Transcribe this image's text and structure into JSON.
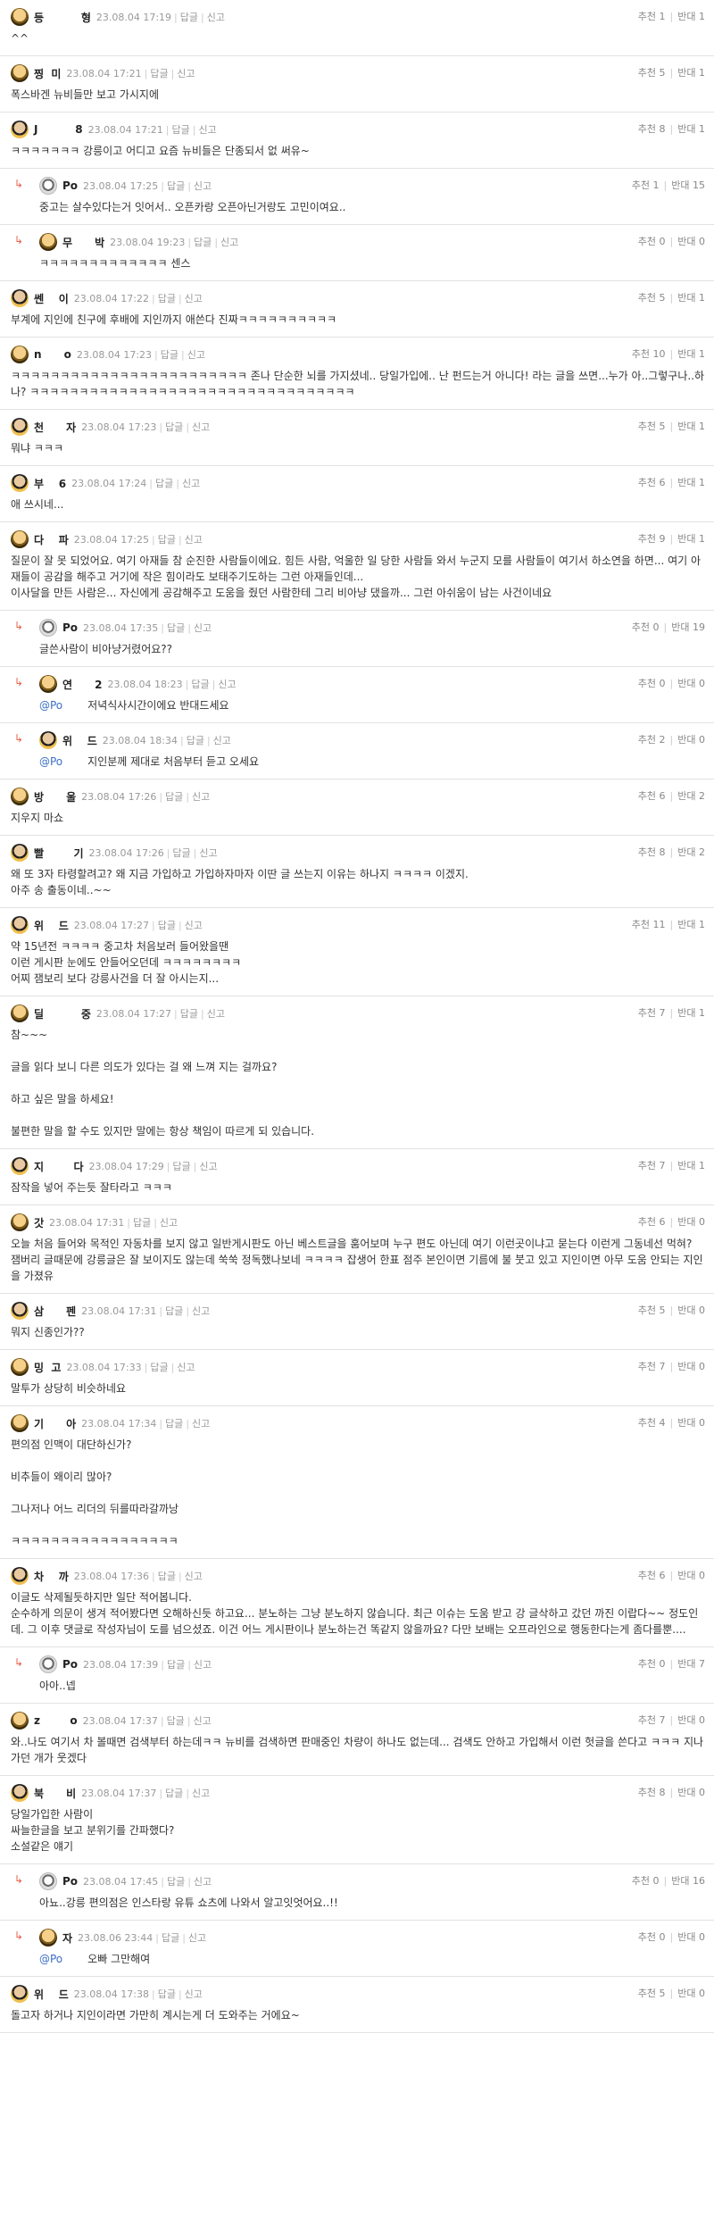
{
  "labels": {
    "reply": "답글",
    "report": "신고",
    "up": "추천",
    "down": "반대"
  },
  "comments": [
    {
      "reply": false,
      "av": "g",
      "nick": "등          형",
      "date": "23.08.04 17:19",
      "up": 1,
      "down": 1,
      "text": "^^"
    },
    {
      "reply": false,
      "av": "g",
      "nick": "찡  미",
      "date": "23.08.04 17:21",
      "up": 5,
      "down": 1,
      "text": "폭스바겐 뉴비들만 보고 가시지에"
    },
    {
      "reply": false,
      "av": "b",
      "nick": "J          8",
      "date": "23.08.04 17:21",
      "up": 8,
      "down": 1,
      "text": "ㅋㅋㅋㅋㅋㅋㅋ 강릉이고 어디고 요즘 뉴비들은 단종되서 없 써유~"
    },
    {
      "reply": true,
      "av": "p",
      "nick": "Po",
      "date": "23.08.04 17:25",
      "up": 1,
      "down": 15,
      "text": "중고는 살수있다는거 잇어서.. 오픈카랑 오픈아닌거랑도 고민이여요.."
    },
    {
      "reply": true,
      "av": "g",
      "nick": "무      박",
      "date": "23.08.04 19:23",
      "up": 0,
      "down": 0,
      "text": "ㅋㅋㅋㅋㅋㅋㅋㅋㅋㅋㅋㅋㅋ 센스"
    },
    {
      "reply": false,
      "av": "b",
      "nick": "쎈    이",
      "date": "23.08.04 17:22",
      "up": 5,
      "down": 1,
      "text": "부계에 지인에 친구에 후배에 지인까지 애쓴다 진짜ㅋㅋㅋㅋㅋㅋㅋㅋㅋㅋ"
    },
    {
      "reply": false,
      "av": "g",
      "nick": "n      o",
      "date": "23.08.04 17:23",
      "up": 10,
      "down": 1,
      "text": "ㅋㅋㅋㅋㅋㅋㅋㅋㅋㅋㅋㅋㅋㅋㅋㅋㅋㅋㅋㅋㅋㅋㅋㅋ 존나 단순한 뇌를 가지셨네.. 당일가입에.. 난 펀드는거 아니다! 라는 글을 쓰면...누가 아..그렇구나..하나? ㅋㅋㅋㅋㅋㅋㅋㅋㅋㅋㅋㅋㅋㅋㅋㅋㅋㅋㅋㅋㅋㅋㅋㅋㅋㅋㅋㅋㅋㅋㅋㅋㅋ"
    },
    {
      "reply": false,
      "av": "b",
      "nick": "천      자",
      "date": "23.08.04 17:23",
      "up": 5,
      "down": 1,
      "text": "뭐냐 ㅋㅋㅋ"
    },
    {
      "reply": false,
      "av": "b",
      "nick": "부    6",
      "date": "23.08.04 17:24",
      "up": 6,
      "down": 1,
      "text": "애 쓰시네..."
    },
    {
      "reply": false,
      "av": "g",
      "nick": "다    파",
      "date": "23.08.04 17:25",
      "up": 9,
      "down": 1,
      "text": "질문이 잘 못 되었어요. 여기 아재들 참 순진한 사람들이에요. 힘든 사람, 억울한 일 당한 사람들 와서 누군지 모를 사람들이 여기서 하소연을 하면... 여기 아재들이 공감을 해주고 거기에 작은 힘이라도 보태주기도하는 그런 아재들인데...\n이사달을 만든 사람은... 자신에게 공감해주고 도움을 줬던 사람한테 그리 비아냥 댔을까... 그런 아쉬움이 남는 사건이네요"
    },
    {
      "reply": true,
      "av": "p",
      "nick": "Po",
      "date": "23.08.04 17:35",
      "up": 0,
      "down": 19,
      "text": "글쓴사람이 비아냥거렸어요??"
    },
    {
      "reply": true,
      "av": "g",
      "nick": "연      2",
      "date": "23.08.04 18:23",
      "up": 0,
      "down": 0,
      "mention": "@Po",
      "text": "저녁식사시간이에요 반대드세요"
    },
    {
      "reply": true,
      "av": "b",
      "nick": "위    드",
      "date": "23.08.04 18:34",
      "up": 2,
      "down": 0,
      "mention": "@Po",
      "text": "지인분께 제대로 처음부터 듣고 오세요"
    },
    {
      "reply": false,
      "av": "g",
      "nick": "방      울",
      "date": "23.08.04 17:26",
      "up": 6,
      "down": 2,
      "text": "지우지 마쇼"
    },
    {
      "reply": false,
      "av": "b",
      "nick": "빨        기",
      "date": "23.08.04 17:26",
      "up": 8,
      "down": 2,
      "text": "왜 또 3자 타령할려고? 왜 지금 가입하고 가입하자마자 이딴 글 쓰는지 이유는 하나지 ㅋㅋㅋㅋ 이겠지.\n아주 송 출동이네..~~"
    },
    {
      "reply": false,
      "av": "b",
      "nick": "위    드",
      "date": "23.08.04 17:27",
      "up": 11,
      "down": 1,
      "text": "약 15년전 ㅋㅋㅋㅋ 중고차 처음보러 들어왔을땐\n이런 게시판 눈에도 안들어오던데 ㅋㅋㅋㅋㅋㅋㅋㅋ\n어찌 잼보리 보다 강릉사건을 더 잘 아시는지..."
    },
    {
      "reply": false,
      "av": "g",
      "nick": "딜          중",
      "date": "23.08.04 17:27",
      "up": 7,
      "down": 1,
      "text": "참~~~\n\n글을 읽다 보니 다른 의도가 있다는 걸 왜 느껴 지는 걸까요?\n\n하고 싶은 말을 하세요!\n\n불편한 말을 할 수도 있지만 말에는 항상 책임이 따르게 되 있습니다."
    },
    {
      "reply": false,
      "av": "b",
      "nick": "지        다",
      "date": "23.08.04 17:29",
      "up": 7,
      "down": 1,
      "text": "잠작을 넣어 주는듯 잘타라고 ㅋㅋㅋ"
    },
    {
      "reply": false,
      "av": "g",
      "nick": "갓",
      "date": "23.08.04 17:31",
      "up": 6,
      "down": 0,
      "text": "오늘 처음 들어와 목적인 자동차를 보지 않고 일반게시판도 아닌 베스트글을 훔어보며 누구 편도 아닌데 여기 이런곳이냐고 묻는다 이런게 그동네선 먹혀? 잼버리 글때문에 강릉글은 잘 보이지도 않는데 쑥쑥 정독했나보네 ㅋㅋㅋㅋ 잡생어 한표 점주 본인이면 기름에 불 붓고 있고 지인이면 아무 도움 안되는 지인을 가졌유"
    },
    {
      "reply": false,
      "av": "b",
      "nick": "삼      펜",
      "date": "23.08.04 17:31",
      "up": 5,
      "down": 0,
      "text": "뭐지 신종인가??"
    },
    {
      "reply": false,
      "av": "g",
      "nick": "밍  고",
      "date": "23.08.04 17:33",
      "up": 7,
      "down": 0,
      "text": "말투가 상당히 비슷하네요"
    },
    {
      "reply": false,
      "av": "g",
      "nick": "기      아",
      "date": "23.08.04 17:34",
      "up": 4,
      "down": 0,
      "text": "편의점 인맥이 대단하신가?\n\n비추들이 왜이리 많아?\n\n그나저나 어느 리더의 뒤를따라갈까낭\n\nㅋㅋㅋㅋㅋㅋㅋㅋㅋㅋㅋㅋㅋㅋㅋㅋㅋ"
    },
    {
      "reply": false,
      "av": "b",
      "nick": "차    까",
      "date": "23.08.04 17:36",
      "up": 6,
      "down": 0,
      "text": "이글도 삭제될듯하지만 일단 적어봅니다.\n순수하게 의문이 생겨 적어봤다면 오해하신듯 하고요... 분노하는 그냥 분노하지 않습니다. 최근 이슈는 도움 받고 강 글삭하고 갔던 까진 이랍다~~ 정도인데. 그 이후 댓글로 작성자님이 도를 넘으셨죠. 이건 어느 게시판이나 분노하는건 똑같지 않을까요? 다만 보배는 오프라인으로 행동한다는게 좀다를뿐...."
    },
    {
      "reply": true,
      "av": "p",
      "nick": "Po",
      "date": "23.08.04 17:39",
      "up": 0,
      "down": 7,
      "text": "아아..넵"
    },
    {
      "reply": false,
      "av": "g",
      "nick": "z        o",
      "date": "23.08.04 17:37",
      "up": 7,
      "down": 0,
      "text": "와..나도 여기서 차 볼때면 검색부터 하는데ㅋㅋ 뉴비를 검색하면 판매중인 차량이 하나도 없는데... 검색도 안하고 가입해서 이런 헛글을 쓴다고 ㅋㅋㅋ 지나가던 개가 웃겠다"
    },
    {
      "reply": false,
      "av": "b",
      "nick": "북      비",
      "date": "23.08.04 17:37",
      "up": 8,
      "down": 0,
      "text": "당일가입한 사람이\n싸늘한글을 보고 분위기를 간파했다?\n소설같은 얘기"
    },
    {
      "reply": true,
      "av": "p",
      "nick": "Po",
      "date": "23.08.04 17:45",
      "up": 0,
      "down": 16,
      "text": "아뇨..강릉 편의점은 인스타랑 유튜 쇼츠에 나와서 알고잇엇어요..!!"
    },
    {
      "reply": true,
      "av": "g",
      "nick": "자",
      "date": "23.08.06 23:44",
      "up": 0,
      "down": 0,
      "mention": "@Po",
      "text": "오빠 그만해여"
    },
    {
      "reply": false,
      "av": "b",
      "nick": "위    드",
      "date": "23.08.04 17:38",
      "up": 5,
      "down": 0,
      "text": "돌고자 하거나 지인이라면 가만히 계시는게 더 도와주는 거에요~"
    }
  ]
}
